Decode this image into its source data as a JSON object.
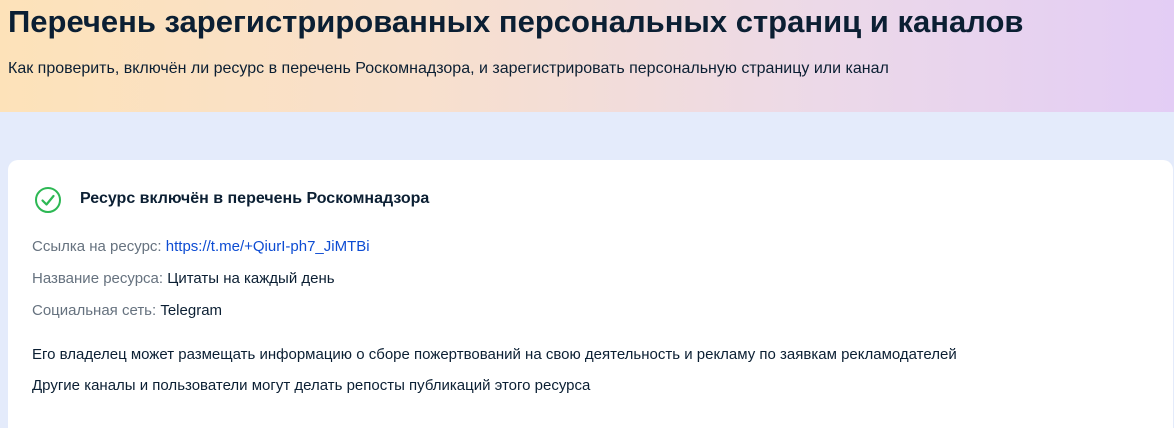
{
  "header": {
    "title": "Перечень зарегистрированных персональных страниц и каналов",
    "subtitle": "Как проверить, включён ли ресурс в перечень Роскомнадзора, и зарегистрировать персональную страницу или канал"
  },
  "result": {
    "status_icon": "check-circle-icon",
    "status_color": "#2db854",
    "status_text": "Ресурс включён в перечень Роскомнадзора",
    "link_label": "Ссылка на ресурс:",
    "link_value": "https://t.me/+QiurI-ph7_JiMTBi",
    "name_label": "Название ресурса:",
    "name_value": "Цитаты на каждый день",
    "network_label": "Социальная сеть:",
    "network_value": "Telegram",
    "notes": [
      "Его владелец может размещать информацию о сборе пожертвований на свою деятельность и рекламу по заявкам рекламодателей",
      "Другие каналы и пользователи могут делать репосты публикаций этого ресурса"
    ]
  }
}
